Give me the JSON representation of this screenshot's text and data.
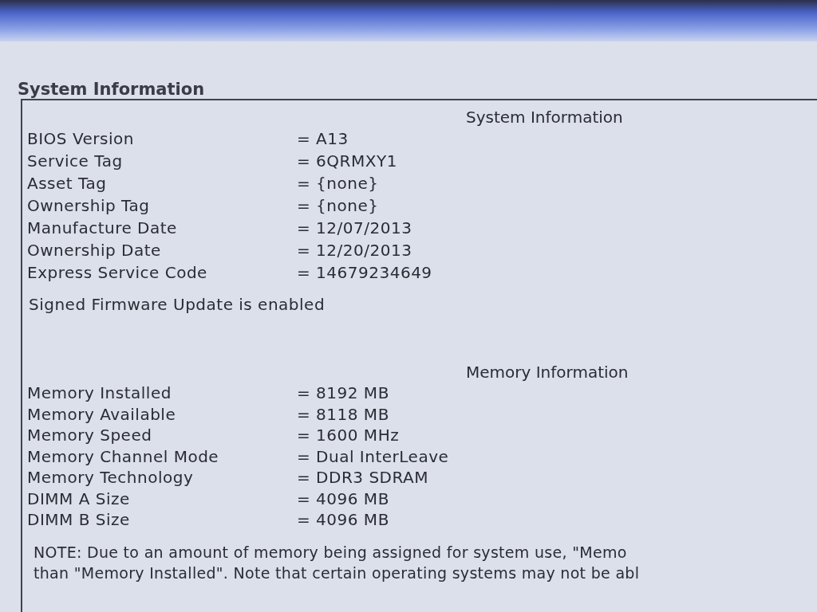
{
  "panel": {
    "title": "System Information"
  },
  "sections": [
    {
      "heading": "System Information",
      "rows": [
        {
          "label": "BIOS Version",
          "value": "= A13"
        },
        {
          "label": "Service Tag",
          "value": "= 6QRMXY1"
        },
        {
          "label": "Asset Tag",
          "value": "= {none}"
        },
        {
          "label": "Ownership Tag",
          "value": "= {none}"
        },
        {
          "label": "Manufacture Date",
          "value": "= 12/07/2013"
        },
        {
          "label": "Ownership Date",
          "value": "= 12/20/2013"
        },
        {
          "label": "Express Service Code",
          "value": "= 14679234649"
        }
      ],
      "message": "Signed Firmware Update is enabled"
    },
    {
      "heading": "Memory Information",
      "rows": [
        {
          "label": "Memory Installed",
          "value": "= 8192 MB"
        },
        {
          "label": "Memory Available",
          "value": "= 8118 MB"
        },
        {
          "label": "Memory Speed",
          "value": "= 1600 MHz"
        },
        {
          "label": "Memory Channel Mode",
          "value": "= Dual InterLeave"
        },
        {
          "label": "Memory Technology",
          "value": "= DDR3 SDRAM"
        },
        {
          "label": "DIMM A Size",
          "value": "= 4096 MB"
        },
        {
          "label": "DIMM B Size",
          "value": "= 4096 MB"
        }
      ]
    }
  ],
  "note": [
    "NOTE: Due to an amount of memory being assigned for system use, \"Memo",
    "than \"Memory Installed\". Note that certain operating systems may not be abl"
  ]
}
